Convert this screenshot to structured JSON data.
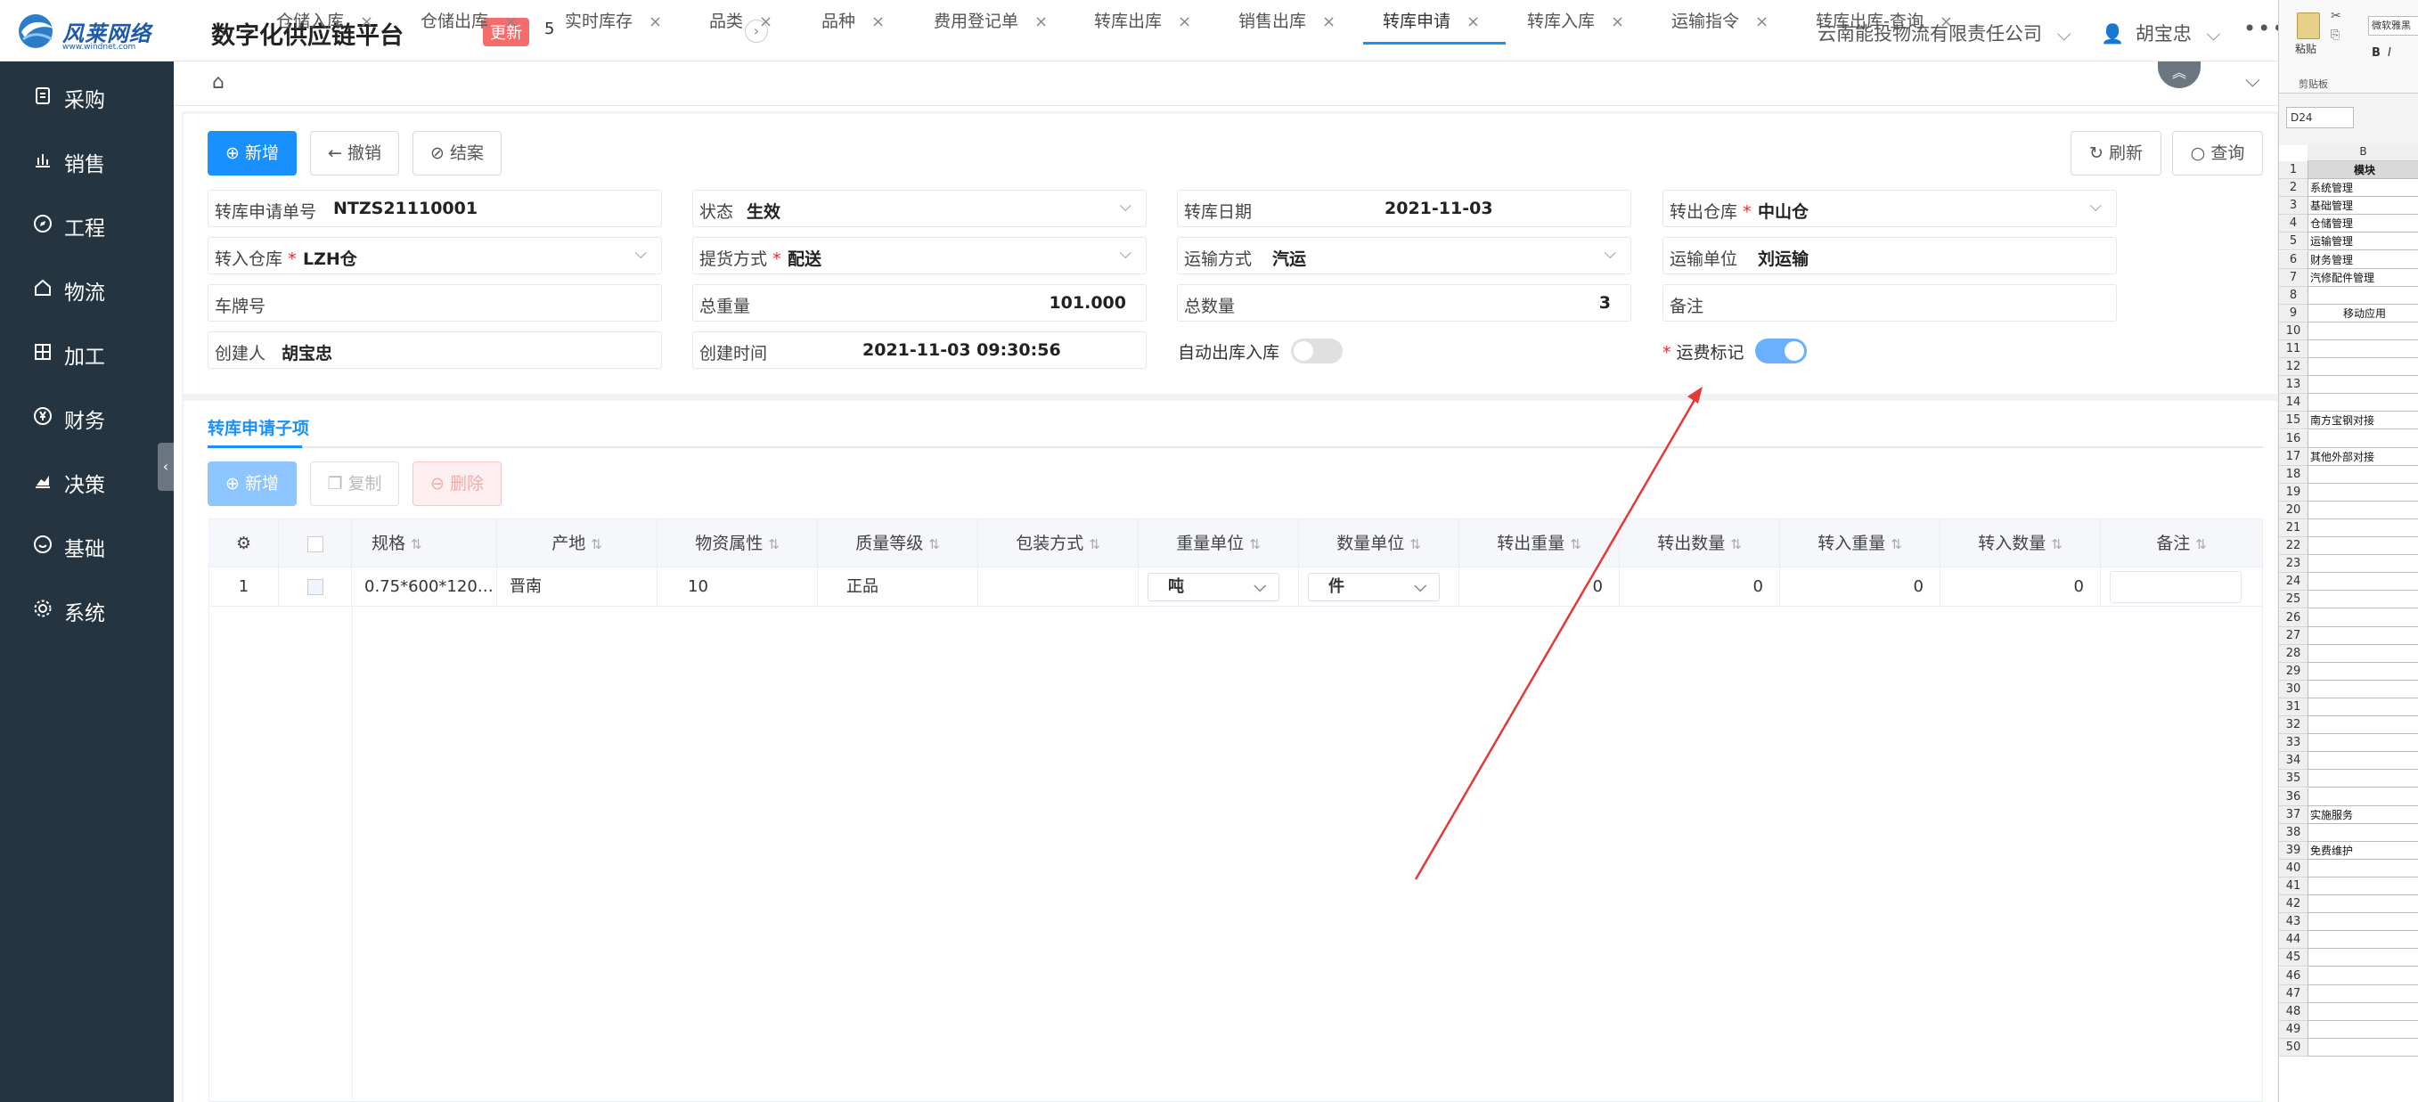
{
  "header": {
    "brand": "风莱网络",
    "brand_url": "www.windnet.com",
    "title": "数字化供应链平台",
    "update_label": "更新",
    "update_count": "5",
    "company": "云南能投物流有限责任公司",
    "user": "胡宝忠"
  },
  "sidebar": {
    "items": [
      {
        "label": "采购",
        "icon": "clipboard-icon"
      },
      {
        "label": "销售",
        "icon": "bar-chart-icon"
      },
      {
        "label": "工程",
        "icon": "compass-icon"
      },
      {
        "label": "物流",
        "icon": "home-icon"
      },
      {
        "label": "加工",
        "icon": "grid-icon"
      },
      {
        "label": "财务",
        "icon": "yen-icon"
      },
      {
        "label": "决策",
        "icon": "area-chart-icon"
      },
      {
        "label": "基础",
        "icon": "smile-icon"
      },
      {
        "label": "系统",
        "icon": "gear-icon"
      }
    ]
  },
  "tabs": [
    {
      "label": "仓储入库"
    },
    {
      "label": "仓储出库"
    },
    {
      "label": "实时库存"
    },
    {
      "label": "品类"
    },
    {
      "label": "品种"
    },
    {
      "label": "费用登记单"
    },
    {
      "label": "转库出库"
    },
    {
      "label": "销售出库"
    },
    {
      "label": "转库申请",
      "active": true
    },
    {
      "label": "转库入库"
    },
    {
      "label": "运输指令"
    },
    {
      "label": "转库出库-查询"
    }
  ],
  "toolbar": {
    "new": "新增",
    "revoke": "撤销",
    "close": "结案",
    "refresh": "刷新",
    "query": "查询"
  },
  "form": {
    "apply_no_label": "转库申请单号",
    "apply_no": "NTZS21110001",
    "status_label": "状态",
    "status": "生效",
    "date_label": "转库日期",
    "date": "2021-11-03",
    "out_wh_label": "转出仓库",
    "out_wh": "中山仓",
    "in_wh_label": "转入仓库",
    "in_wh": "LZH仓",
    "pickup_label": "提货方式",
    "pickup": "配送",
    "transport_label": "运输方式",
    "transport": "汽运",
    "carrier_label": "运输单位",
    "carrier": "刘运输",
    "plate_label": "车牌号",
    "plate": "",
    "total_weight_label": "总重量",
    "total_weight": "101.000",
    "total_qty_label": "总数量",
    "total_qty": "3",
    "remark_label": "备注",
    "remark": "",
    "creator_label": "创建人",
    "creator": "胡宝忠",
    "created_label": "创建时间",
    "created": "2021-11-03 09:30:56",
    "auto_label": "自动出库入库",
    "auto_on": false,
    "freight_label": "运费标记",
    "freight_on": true,
    "required_mark": "*"
  },
  "sub": {
    "title": "转库申请子项",
    "new": "新增",
    "copy": "复制",
    "delete": "删除",
    "columns": [
      "规格",
      "产地",
      "物资属性",
      "质量等级",
      "包装方式",
      "重量单位",
      "数量单位",
      "转出重量",
      "转出数量",
      "转入重量",
      "转入数量",
      "备注"
    ],
    "rows": [
      {
        "index": "1",
        "spec": "0.75*600*120…",
        "origin": "晋南",
        "attr": "10",
        "grade": "正品",
        "pack": "",
        "weight_unit": "吨",
        "qty_unit": "件",
        "out_weight": "0",
        "out_qty": "0",
        "in_weight": "0",
        "in_qty": "0",
        "remark": ""
      }
    ]
  },
  "excel": {
    "paste": "粘贴",
    "clipboard": "剪贴板",
    "font": "微软雅黑",
    "bold": "B",
    "italic": "I",
    "namebox": "D24",
    "col_b": "B",
    "cells": [
      {
        "r": "1",
        "t": "模块"
      },
      {
        "r": "2",
        "t": "系统管理"
      },
      {
        "r": "3",
        "t": "基础管理"
      },
      {
        "r": "4",
        "t": "仓储管理"
      },
      {
        "r": "5",
        "t": "运输管理"
      },
      {
        "r": "6",
        "t": "财务管理"
      },
      {
        "r": "7",
        "t": "汽修配件管理"
      },
      {
        "r": "8",
        "t": ""
      },
      {
        "r": "9",
        "t": "移动应用"
      },
      {
        "r": "10",
        "t": ""
      },
      {
        "r": "11",
        "t": ""
      },
      {
        "r": "12",
        "t": ""
      },
      {
        "r": "13",
        "t": ""
      },
      {
        "r": "14",
        "t": ""
      },
      {
        "r": "15",
        "t": "南方宝钢对接"
      },
      {
        "r": "16",
        "t": ""
      },
      {
        "r": "17",
        "t": "其他外部对接"
      },
      {
        "r": "18",
        "t": ""
      },
      {
        "r": "19",
        "t": ""
      },
      {
        "r": "20",
        "t": ""
      },
      {
        "r": "21",
        "t": ""
      },
      {
        "r": "22",
        "t": ""
      },
      {
        "r": "23",
        "t": ""
      },
      {
        "r": "24",
        "t": ""
      },
      {
        "r": "25",
        "t": ""
      },
      {
        "r": "26",
        "t": ""
      },
      {
        "r": "27",
        "t": ""
      },
      {
        "r": "28",
        "t": ""
      },
      {
        "r": "29",
        "t": ""
      },
      {
        "r": "30",
        "t": ""
      },
      {
        "r": "31",
        "t": ""
      },
      {
        "r": "32",
        "t": ""
      },
      {
        "r": "33",
        "t": ""
      },
      {
        "r": "34",
        "t": ""
      },
      {
        "r": "35",
        "t": ""
      },
      {
        "r": "36",
        "t": ""
      },
      {
        "r": "37",
        "t": "实施服务"
      },
      {
        "r": "38",
        "t": ""
      },
      {
        "r": "39",
        "t": "免费维护"
      },
      {
        "r": "40",
        "t": ""
      },
      {
        "r": "41",
        "t": ""
      },
      {
        "r": "42",
        "t": ""
      },
      {
        "r": "43",
        "t": ""
      },
      {
        "r": "44",
        "t": ""
      },
      {
        "r": "45",
        "t": ""
      },
      {
        "r": "46",
        "t": ""
      },
      {
        "r": "47",
        "t": ""
      },
      {
        "r": "48",
        "t": ""
      },
      {
        "r": "49",
        "t": ""
      },
      {
        "r": "50",
        "t": ""
      }
    ]
  },
  "colors": {
    "sidebar_bg": "#243440",
    "primary": "#1890ff",
    "update_badge": "#f56c6c",
    "arrow": "#e53935"
  }
}
